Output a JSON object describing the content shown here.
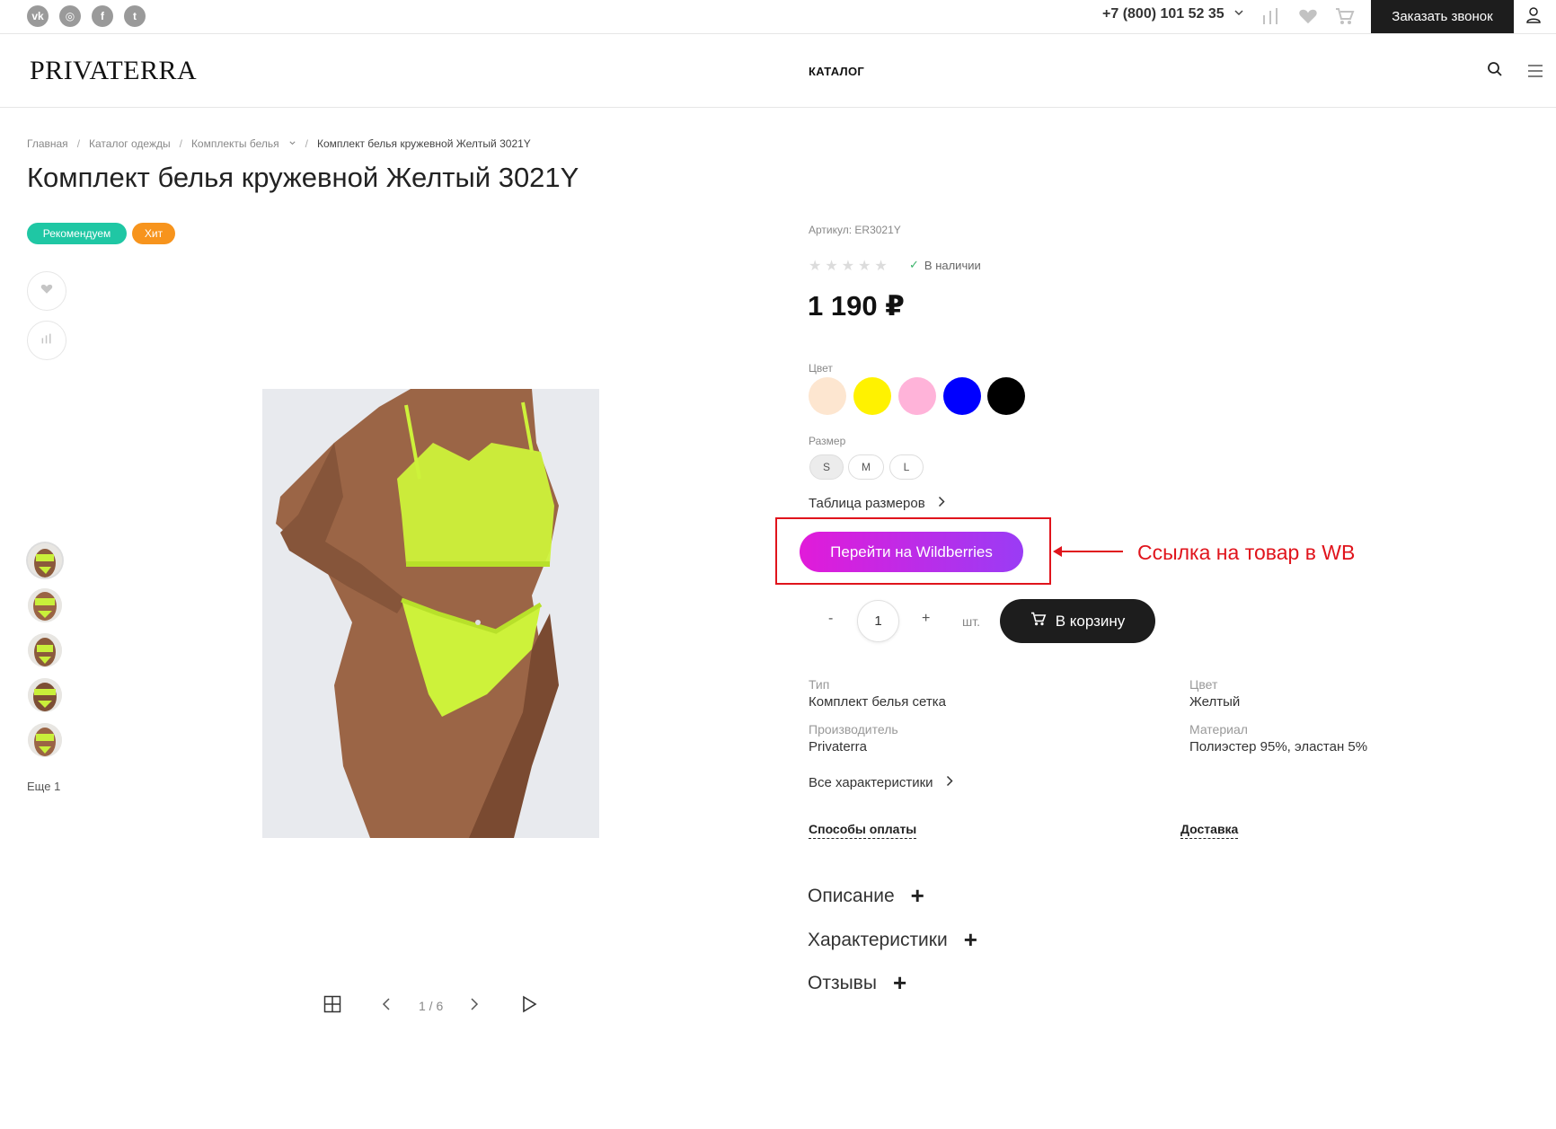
{
  "topbar": {
    "social": [
      {
        "icon": "vk-icon",
        "glyph": "vk"
      },
      {
        "icon": "instagram-icon",
        "glyph": "◎"
      },
      {
        "icon": "facebook-icon",
        "glyph": "f"
      },
      {
        "icon": "twitter-icon",
        "glyph": "t"
      }
    ],
    "phone": "+7 (800) 101 52 35",
    "callback_label": "Заказать звонок"
  },
  "header": {
    "logo": "PRIVATERRA",
    "catalog_label": "КАТАЛОГ"
  },
  "breadcrumbs": [
    "Главная",
    "Каталог одежды",
    "Комплекты белья",
    "Комплект белья кружевной Желтый 3021Y"
  ],
  "product": {
    "title": "Комплект белья кружевной Желтый 3021Y",
    "badges": [
      {
        "label": "Рекомендуем",
        "color": "#1fc7a4"
      },
      {
        "label": "Хит",
        "color": "#f7941d"
      }
    ],
    "sku": "Артикул: ER3021Y",
    "rating_stars": 0,
    "stock": "В наличии",
    "price": "1 190 ₽",
    "color_label": "Цвет",
    "colors": [
      "#fde6d0",
      "#fff200",
      "#ffb3d9",
      "#0000ff",
      "#000000"
    ],
    "size_label": "Размер",
    "sizes": [
      "S",
      "M",
      "L"
    ],
    "selected_size": "S",
    "size_table_label": "Таблица размеров",
    "wb_button": "Перейти на Wildberries",
    "annotation": "Ссылка на товар в WB",
    "qty_minus": "-",
    "qty_value": "1",
    "qty_plus": "+",
    "qty_unit": "шт.",
    "cart_button": "В корзину",
    "props": [
      {
        "key": "Тип",
        "value": "Комплект белья сетка"
      },
      {
        "key": "Цвет",
        "value": "Желтый"
      },
      {
        "key": "Производитель",
        "value": "Privaterra"
      },
      {
        "key": "Материал",
        "value": "Полиэстер 95%, эластан 5%"
      }
    ],
    "all_chars_label": "Все характеристики",
    "payment_label": "Способы оплаты",
    "delivery_label": "Доставка",
    "accordion": [
      "Описание",
      "Характеристики",
      "Отзывы"
    ]
  },
  "gallery": {
    "more_label": "Еще 1",
    "counter": "1 / 6",
    "accent_color": "#d7f542"
  }
}
